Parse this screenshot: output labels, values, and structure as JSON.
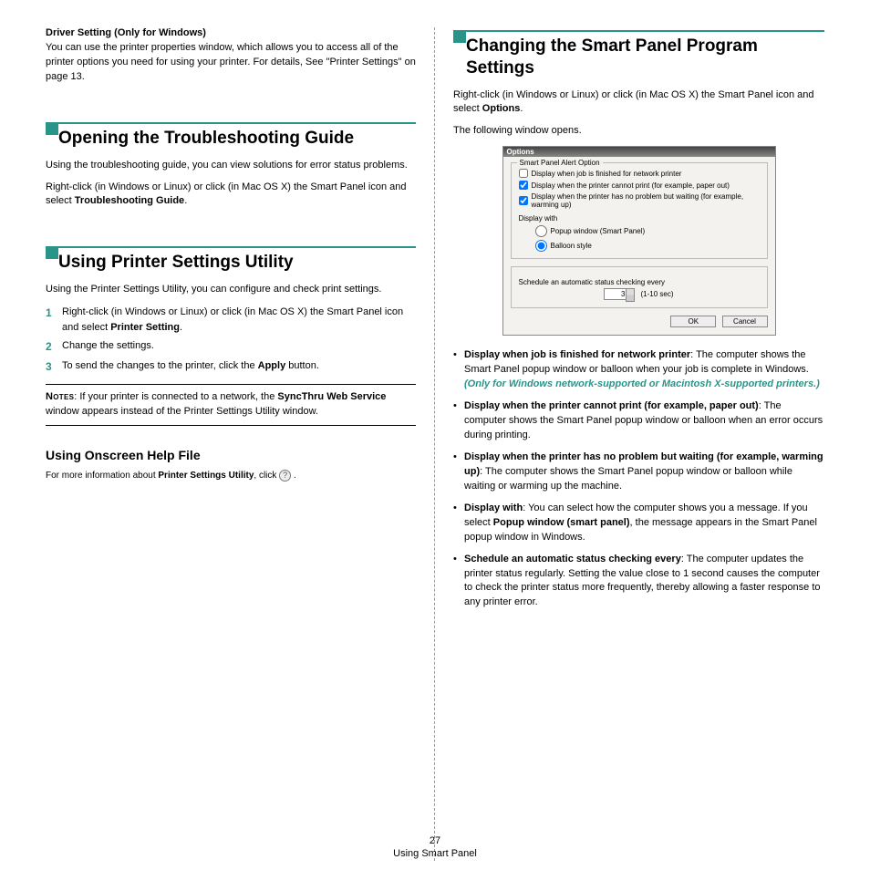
{
  "left": {
    "driver_heading": "Driver Setting (Only for Windows)",
    "driver_body": "You can use the printer properties window, which allows you to access all of the printer options you need for using your printer. For details, See \"Printer Settings\" on page 13.",
    "sec1": {
      "title": "Opening the Troubleshooting Guide",
      "p1": "Using the troubleshooting guide, you can view solutions for error status problems.",
      "p2_a": "Right-click (in Windows or Linux) or click (in Mac OS X) the Smart Panel icon and select ",
      "p2_b": "Troubleshooting Guide",
      "p2_c": "."
    },
    "sec2": {
      "title": "Using Printer Settings Utility",
      "p1": "Using the Printer Settings Utility, you can configure and check print settings.",
      "step1_a": "Right-click (in Windows or Linux) or click (in Mac OS X) the Smart Panel icon and select ",
      "step1_b": "Printer Setting",
      "step1_c": ".",
      "step2": "Change the settings.",
      "step3_a": "To send the changes to the printer, click the ",
      "step3_b": "Apply",
      "step3_c": " button.",
      "notes_label": "Notes",
      "notes_a": ": If your printer is connected to a network, the ",
      "notes_b": "SyncThru Web Service",
      "notes_c": " window appears instead of the Printer Settings Utility window.",
      "h2": "Using Onscreen Help File",
      "help_a": "For more information about ",
      "help_b": "Printer Settings Utility",
      "help_c": ", click ",
      "help_d": " ."
    }
  },
  "right": {
    "title": "Changing the Smart Panel Program Settings",
    "p1_a": "Right-click (in Windows or Linux) or click (in Mac OS X) the Smart Panel icon and select ",
    "p1_b": "Options",
    "p1_c": ".",
    "p2": "The following window opens.",
    "dialog": {
      "title": "Options",
      "legend": "Smart Panel Alert Option",
      "c1": "Display when job is finished for network printer",
      "c2": "Display when the printer cannot print (for example, paper out)",
      "c3": "Display when the printer has no problem but waiting (for example, warming up)",
      "dw": "Display with",
      "r1": "Popup window (Smart Panel)",
      "r2": "Balloon style",
      "sched": "Schedule an automatic status checking every",
      "spin": "3",
      "range": "(1-10 sec)",
      "ok": "OK",
      "cancel": "Cancel"
    },
    "b1_a": "Display when job is finished for network printer",
    "b1_b": ": The computer shows the Smart Panel popup window or balloon when your job is complete in Windows. ",
    "b1_c": "(Only for Windows network-supported or Macintosh X-supported printers.)",
    "b2_a": "Display when the printer cannot print (for  example, paper out)",
    "b2_b": ": The computer shows the Smart Panel popup window or balloon when an error occurs during printing.",
    "b3_a": "Display when the printer has no problem but waiting (for  example, warming up)",
    "b3_b": ": The computer shows the Smart Panel popup window or balloon while waiting or warming up the machine.",
    "b4_a": "Display with",
    "b4_b": ": You can select how the computer shows you a message. If you select ",
    "b4_c": "Popup window (smart panel)",
    "b4_d": ", the message appears in the Smart Panel popup window in Windows.",
    "b5_a": "Schedule an automatic status checking every",
    "b5_b": ": The computer updates the printer status regularly. Setting the value close to 1 second causes the computer to check the printer status more frequently, thereby allowing a faster response to any printer error."
  },
  "footer": {
    "page": "27",
    "section": "Using Smart Panel"
  }
}
